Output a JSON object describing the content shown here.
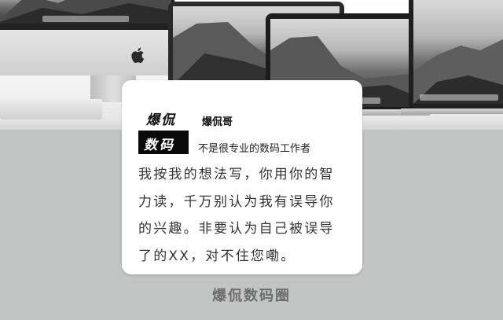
{
  "card": {
    "logo_line1": "爆侃",
    "logo_line2": "数码",
    "author_name": "爆侃哥",
    "author_desc": "不是很专业的数码工作者",
    "body_lines": [
      "我按我的想法写，你用你的智",
      "力读，千万别认为我有误导你",
      "的兴趣。非要认为自己被误导",
      "了的XX，对不住您嘞。"
    ]
  },
  "footer": {
    "label": "爆侃数码圈"
  }
}
